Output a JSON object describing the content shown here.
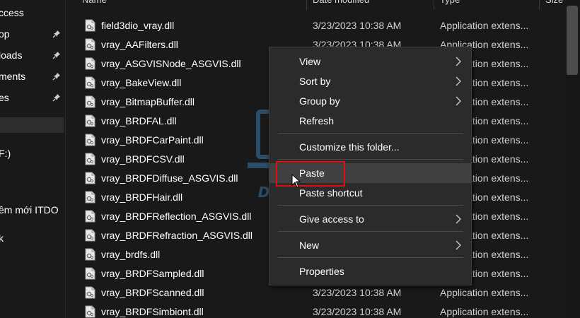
{
  "nav": {
    "items": [
      {
        "label": "ccess",
        "pinned": false
      },
      {
        "label": "op",
        "pinned": true
      },
      {
        "label": "loads",
        "pinned": true
      },
      {
        "label": "ments",
        "pinned": true
      },
      {
        "label": "es",
        "pinned": true
      },
      {
        "label": "",
        "selected": true
      },
      {
        "label": "F:)"
      },
      {
        "label": "ềm mới ITDO"
      },
      {
        "label": "k"
      }
    ]
  },
  "columns": {
    "name": "Name",
    "date": "Date modified",
    "type": "Type",
    "size": "Size"
  },
  "files": [
    {
      "name": "field3dio_vray.dll",
      "date": "3/23/2023 10:38 AM",
      "type": "Application extens..."
    },
    {
      "name": "vray_AAFilters.dll",
      "date": "3/23/2023 10:38 AM",
      "type": "Application extens..."
    },
    {
      "name": "vray_ASGVISNode_ASGVIS.dll",
      "date": "",
      "type": "Application extens..."
    },
    {
      "name": "vray_BakeView.dll",
      "date": "",
      "type": "Application extens..."
    },
    {
      "name": "vray_BitmapBuffer.dll",
      "date": "",
      "type": "Application extens..."
    },
    {
      "name": "vray_BRDFAL.dll",
      "date": "",
      "type": "Application extens..."
    },
    {
      "name": "vray_BRDFCarPaint.dll",
      "date": "",
      "type": "Application extens..."
    },
    {
      "name": "vray_BRDFCSV.dll",
      "date": "",
      "type": "Application extens..."
    },
    {
      "name": "vray_BRDFDiffuse_ASGVIS.dll",
      "date": "",
      "type": "Application extens..."
    },
    {
      "name": "vray_BRDFHair.dll",
      "date": "",
      "type": "Application extens..."
    },
    {
      "name": "vray_BRDFReflection_ASGVIS.dll",
      "date": "",
      "type": "Application extens..."
    },
    {
      "name": "vray_BRDFRefraction_ASGVIS.dll",
      "date": "",
      "type": "Application extens..."
    },
    {
      "name": "vray_brdfs.dll",
      "date": "",
      "type": "Application extens..."
    },
    {
      "name": "vray_BRDFSampled.dll",
      "date": "",
      "type": "Application extens..."
    },
    {
      "name": "vray_BRDFScanned.dll",
      "date": "3/23/2023 10:38 AM",
      "type": "Application extens..."
    },
    {
      "name": "vray_BRDFSimbiont.dll",
      "date": "3/23/2023 10:38 AM",
      "type": "Application extens..."
    }
  ],
  "context_menu": {
    "items": [
      {
        "label": "View",
        "submenu": true
      },
      {
        "label": "Sort by",
        "submenu": true
      },
      {
        "label": "Group by",
        "submenu": true
      },
      {
        "label": "Refresh"
      },
      {
        "separator": true
      },
      {
        "label": "Customize this folder..."
      },
      {
        "separator": true
      },
      {
        "label": "Paste",
        "hover": true,
        "highlighted": true
      },
      {
        "label": "Paste shortcut"
      },
      {
        "separator": true
      },
      {
        "label": "Give access to",
        "submenu": true
      },
      {
        "separator": true
      },
      {
        "label": "New",
        "submenu": true
      },
      {
        "separator": true
      },
      {
        "label": "Properties"
      }
    ]
  },
  "watermark": {
    "text": "DOLOZI"
  },
  "colors": {
    "background": "#191919",
    "menu": "#2b2b2b",
    "highlight_border": "#e01010"
  }
}
